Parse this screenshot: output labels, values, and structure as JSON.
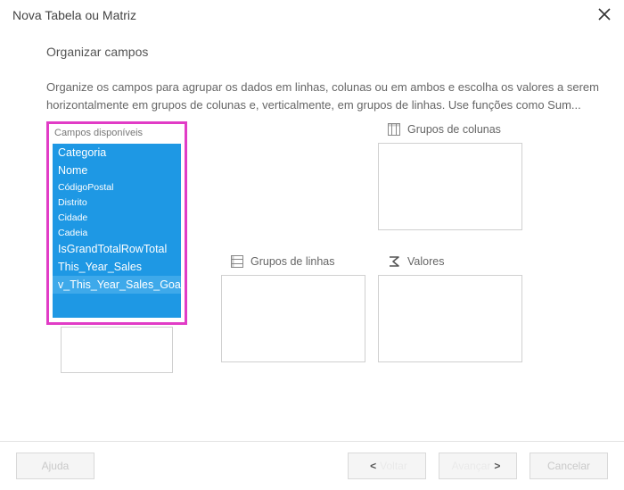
{
  "dialog": {
    "title": "Nova Tabela ou Matriz"
  },
  "heading": "Organizar campos",
  "description": "Organize os campos para agrupar os dados em linhas, colunas ou em ambos e escolha os valores a serem horizontalmente em grupos de colunas e, verticalmente, em grupos de linhas. Use funções como Sum...",
  "fields": {
    "label": "Campos disponíveis",
    "items": [
      "Categoria",
      "Nome",
      "CódigoPostal",
      "Distrito",
      "Cidade",
      "Cadeia",
      "IsGrandTotalRowTotal",
      "This_Year_Sales",
      "v_This_Year_Sales_Goal"
    ]
  },
  "zones": {
    "columns_label": "Grupos de colunas",
    "rows_label": "Grupos de linhas",
    "values_label": "Valores"
  },
  "buttons": {
    "help": "Ajuda",
    "back_faded": "Voltar",
    "next_faded": "Avançar",
    "cancel": "Cancelar"
  }
}
